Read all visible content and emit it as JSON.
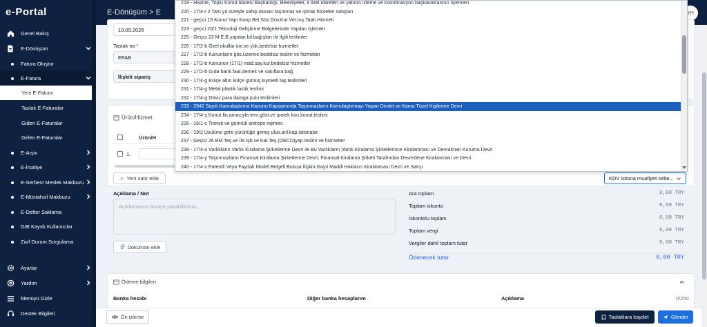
{
  "app": {
    "logo": "e-Portal"
  },
  "topbar": {
    "breadcrumb": "E-Dönüşüm > E",
    "avatar_initials": "YH"
  },
  "sidebar": {
    "items": [
      {
        "label": "Genel Bakış",
        "icon": "home-icon"
      },
      {
        "label": "E-Dönüşüm",
        "icon": "document-icon"
      },
      {
        "label": "Fatura Oluştur"
      },
      {
        "label": "E-Fatura"
      },
      {
        "label": "Yeni E-Fatura"
      },
      {
        "label": "Taslak E-Faturalar"
      },
      {
        "label": "Giden E-Faturalar"
      },
      {
        "label": "Gelen E-Faturalar"
      },
      {
        "label": "E-Arşiv"
      },
      {
        "label": "E-İrsaliye"
      },
      {
        "label": "E-Serbest Meslek Makbuzu"
      },
      {
        "label": "E-Müstahsil Makbuzu"
      },
      {
        "label": "E-Defter Saklama"
      },
      {
        "label": "GİB Kayıtlı Kullanıcılar"
      },
      {
        "label": "Zarf Durum Sorgulama"
      },
      {
        "label": "Ayarlar",
        "icon": "gear-icon"
      },
      {
        "label": "Yardım",
        "icon": "help-icon"
      },
      {
        "label": "Menüyü Gizle",
        "icon": "menu-icon"
      },
      {
        "label": "Destek Bilgileri",
        "icon": "support-icon"
      }
    ]
  },
  "form": {
    "date_value": "10.09.2026",
    "draft_label": "Taslak no *",
    "draft_value": "EFAB",
    "related_order": "İlişkili sipariş",
    "products_title": "Ürün/Hizmet",
    "products_col": "Ürün/H",
    "row_number": "1.",
    "add_row": "Yeni satır ekle",
    "kdv_select": "KDV istisna muafiyet sebe...",
    "note_label": "Açıklama / Not",
    "note_placeholder": "Açıklamanızı buraya yazabilirsiniz....",
    "attach_doc": "Doküman ekle"
  },
  "totals": [
    {
      "label": "Ara toplam",
      "value": "0,00 TRY"
    },
    {
      "label": "Toplam iskonto",
      "value": "0,00 TRY"
    },
    {
      "label": "İskontolu toplam",
      "value": "0,00 TRY"
    },
    {
      "label": "Toplam vergi",
      "value": "0,00 TRY"
    },
    {
      "label": "Vergiler dahil toplam tutar",
      "value": "0,00 TRY"
    },
    {
      "label": "Ödenecek tutar",
      "value": "0,00 TRY"
    }
  ],
  "payment": {
    "title": "Ödeme bilgileri",
    "bank_account": "Banka hesabı",
    "other_accounts": "Diğer banka hesaplarım",
    "description": "Açıklama",
    "char_count": "0/250"
  },
  "bottom": {
    "preview": "Ön izleme",
    "save_draft": "Taslaklara kaydet",
    "send": "Gönder"
  },
  "dropdown": {
    "selected_index": 14,
    "items": [
      "219 - Hazine, Toplu Konut İdaresi Başkanlığı, Belediyeler, il özel idareleri ve yatırım izleme ve koordinasyon başkanlıklarının İşlemleri",
      "220 - 17/4-r 2 Tam yıl süreyle sahip olunan taşınmaz ve iştirak hisseleri satışları",
      "221 - geçici 15 Konut Yapı Koop Bel.Söz.Güv.Kur.Ver.İnş.Taah.Hizmeti",
      "223 - geçici 20/1 Teknoloji Geliştirme Bölgelerinde Yapılan İşlemler",
      "225 - Geçici 23 M.E.B.yapılan bil.bağışları ile ilgili teslimler",
      "226 - 17/2-b Özel okullar üni.ve yük.bedelsiz hizmetler",
      "227 - 17/2-b Kanunların gös.üzerine bedelsiz teslim ve hizmetler",
      "228 - 17/2-b Kanunun (17/1) mad.say.kur.bedelsiz hizmetler",
      "229 - 17/2-b Gıda bank.faal.dernek ve vakıflara bağ.",
      "230 - 17/4-g Külçe altın külçe gümüş kıymetli taş teslimleri",
      "231 - 17/4-g Metal plastik lastik teslimi",
      "232 - 17/4-g Döviz para damga pulu teslimleri",
      "233 - 2942 Sayılı Kamulaştırma Kanunu Kapsamında Taşınmazların Kamulaştırmayı Yapan Devlet ve Kamu Tüzel Kişilerine Devri",
      "234 - 17/4-ş Konut fin.amacıyla tem.göst.ve ipotek kon.konut.teslimi",
      "235 - 16/1-c Transit ve gümrük antrepo rejimler.",
      "236 - 19/2 Usulüne göre yürürlüğe girmiş ulus.anl.kap.istisnalar",
      "237 - Geçici 26 BM Teş.ve İkt.İşb.ve Kal.Teş.(OECD)yap.teslim ve hizmetler",
      "238 - 17/4-u Varlıkların Varlık Kiralama Şirketlerine Devri ile Bu Varlıkların Varlık Kiralama Şirketlerince Kiralanması ve Devralınan Kuruma Devri",
      "239 - 17/4-y Taşınmazların Finansal Kiralama Şirketlerine Devri, Finansal Kiralama Şirketi Tarafından Devredene Kiralanması ve Devri",
      "240 - 17/4-z Patentli Veya Faydalı Model Belgeli Buluşa İlişkin Gayri Maddi Hakların Kiralanması Devri ve Satışı"
    ]
  }
}
